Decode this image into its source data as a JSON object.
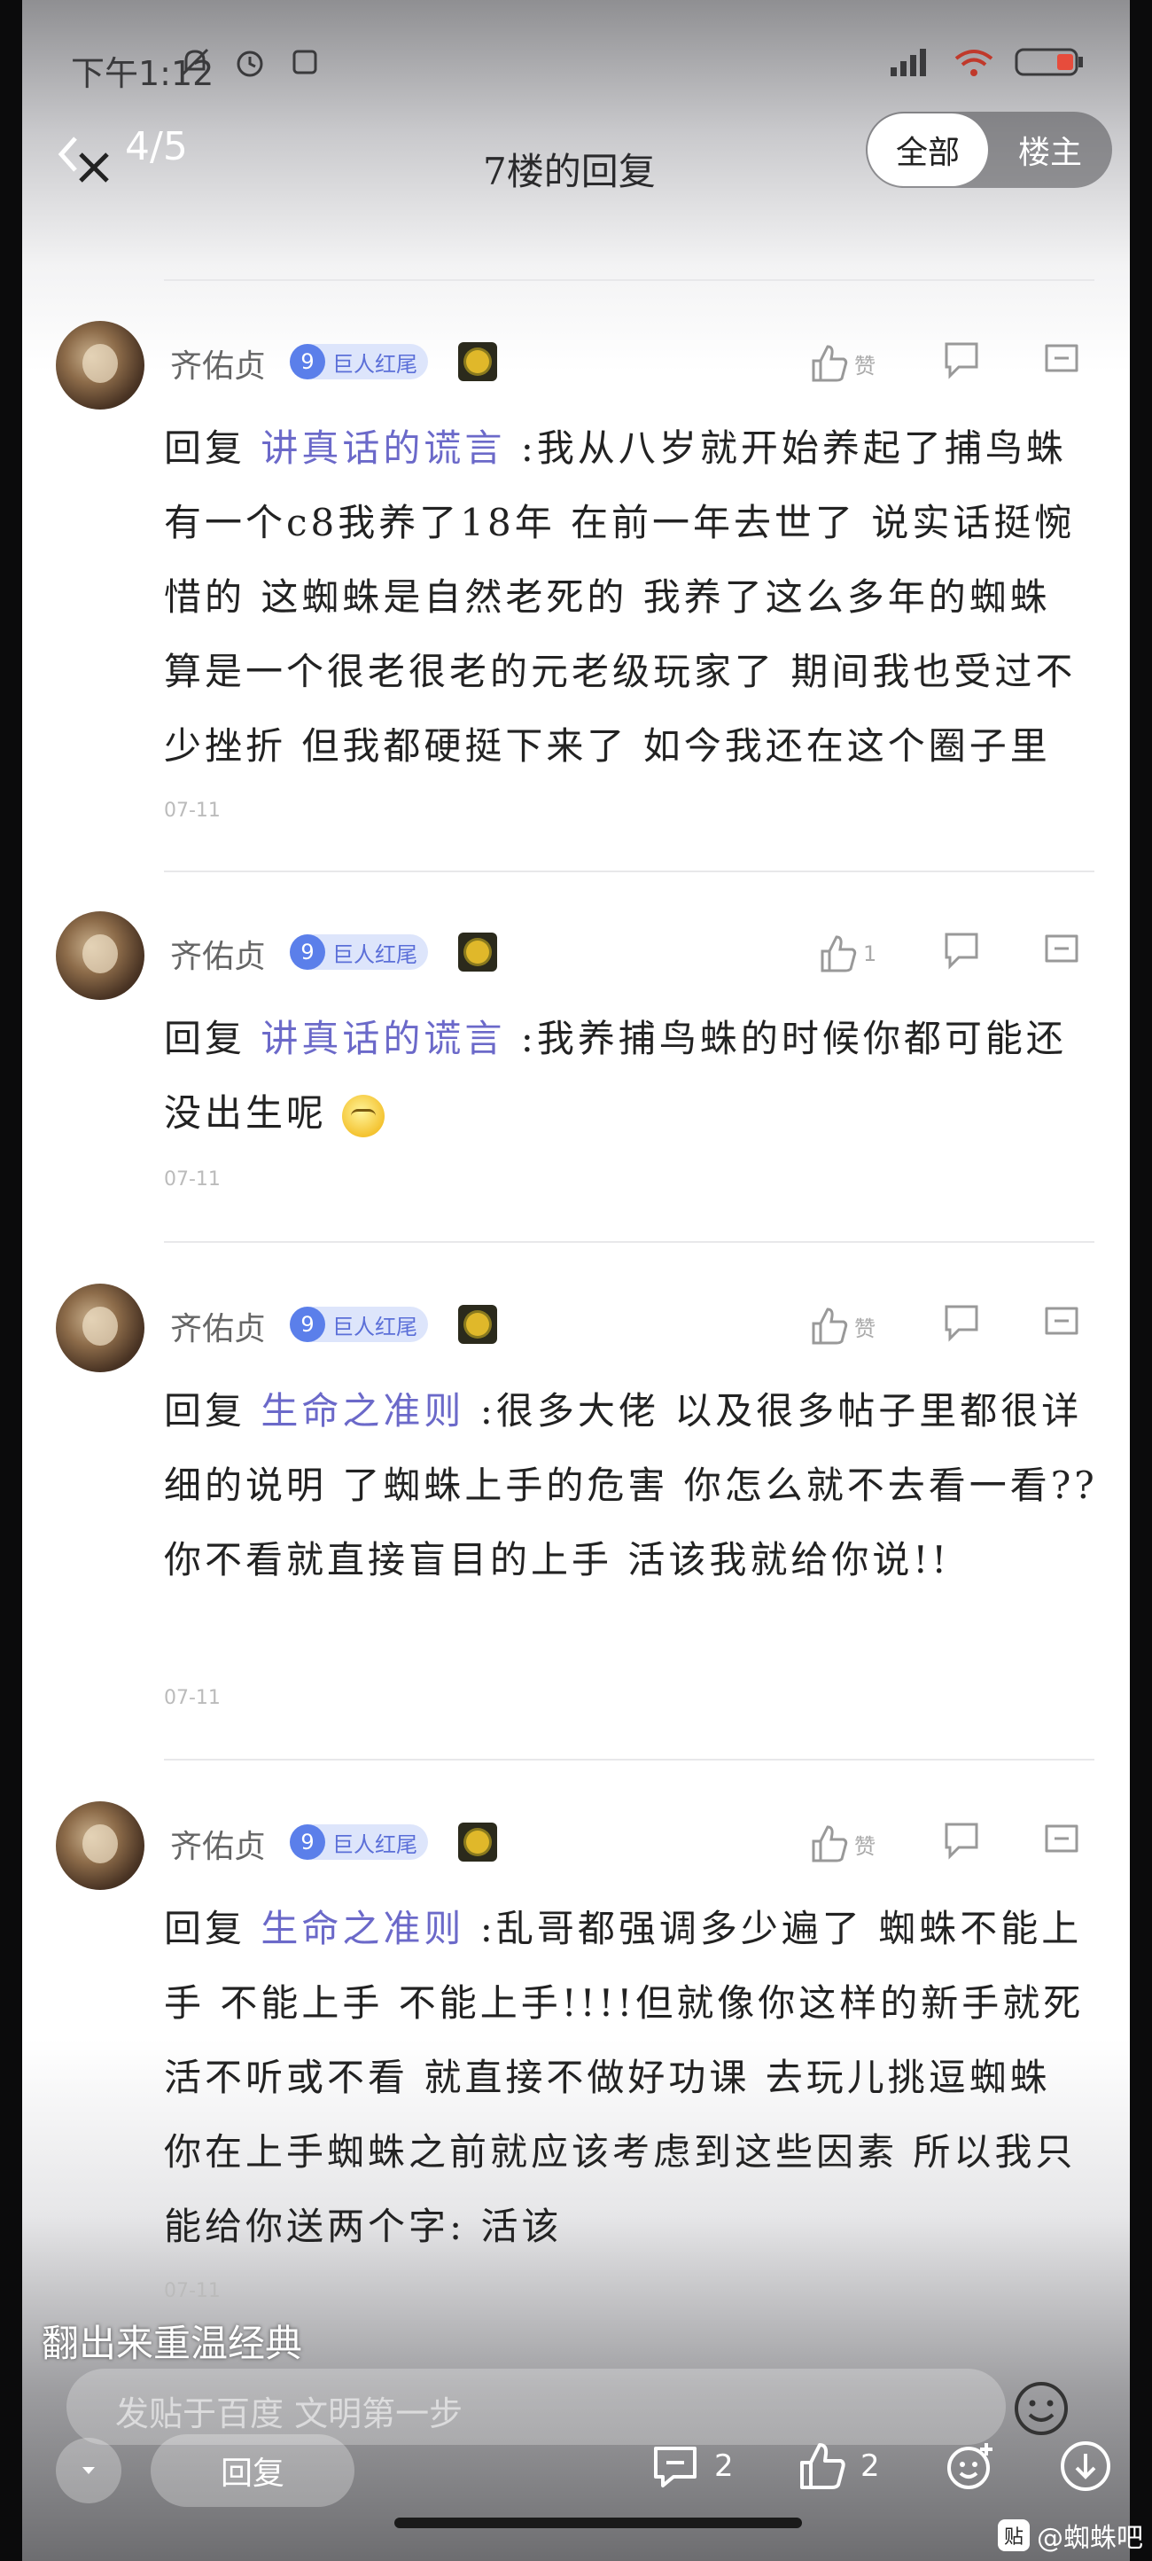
{
  "status_bar": {
    "time": "下午1:12"
  },
  "nav": {
    "page_counter": "4/5",
    "title": "7楼的回复",
    "segment_all": "全部",
    "segment_owner": "楼主"
  },
  "comments": [
    {
      "username": "齐佑贞",
      "level": "9",
      "badge_name": "巨人红尾",
      "like_label": "赞",
      "reply_prefix": "回复",
      "reply_target": "讲真话的谎言",
      "text": ":我从八岁就开始养起了捕鸟蛛 有一个c8我养了18年 在前一年去世了 说实话挺惋惜的 这蜘蛛是自然老死的 我养了这么多年的蜘蛛 算是一个很老很老的元老级玩家了 期间我也受过不少挫折 但我都硬挺下来了 如今我还在这个圈子里",
      "date": "07-11"
    },
    {
      "username": "齐佑贞",
      "level": "9",
      "badge_name": "巨人红尾",
      "like_label": "1",
      "reply_prefix": "回复",
      "reply_target": "讲真话的谎言",
      "text": ":我养捕鸟蛛的时候你都可能还没出生呢",
      "date": "07-11"
    },
    {
      "username": "齐佑贞",
      "level": "9",
      "badge_name": "巨人红尾",
      "like_label": "赞",
      "reply_prefix": "回复",
      "reply_target": "生命之准则",
      "text": ":很多大佬 以及很多帖子里都很详细的说明 了蜘蛛上手的危害 你怎么就不去看一看?? 你不看就直接盲目的上手 活该我就给你说!!",
      "date": "07-11"
    },
    {
      "username": "齐佑贞",
      "level": "9",
      "badge_name": "巨人红尾",
      "like_label": "赞",
      "reply_prefix": "回复",
      "reply_target": "生命之准则",
      "text": ":乱哥都强调多少遍了 蜘蛛不能上手 不能上手 不能上手!!!!但就像你这样的新手就死活不听或不看 就直接不做好功课 去玩儿挑逗蜘蛛 你在上手蜘蛛之前就应该考虑到这些因素 所以我只能给你送两个字: 活该",
      "date": "07-11"
    }
  ],
  "overlay_caption": "翻出来重温经典",
  "input": {
    "placeholder": "发贴于百度 文明第一步"
  },
  "bottom_bar": {
    "reply_label": "回复",
    "comment_count": "2",
    "like_count": "2"
  },
  "watermark": {
    "logo": "贴",
    "text": "@蜘蛛吧"
  },
  "colors": {
    "reply_target": "#6b69c9",
    "badge": "#5b7fea"
  }
}
